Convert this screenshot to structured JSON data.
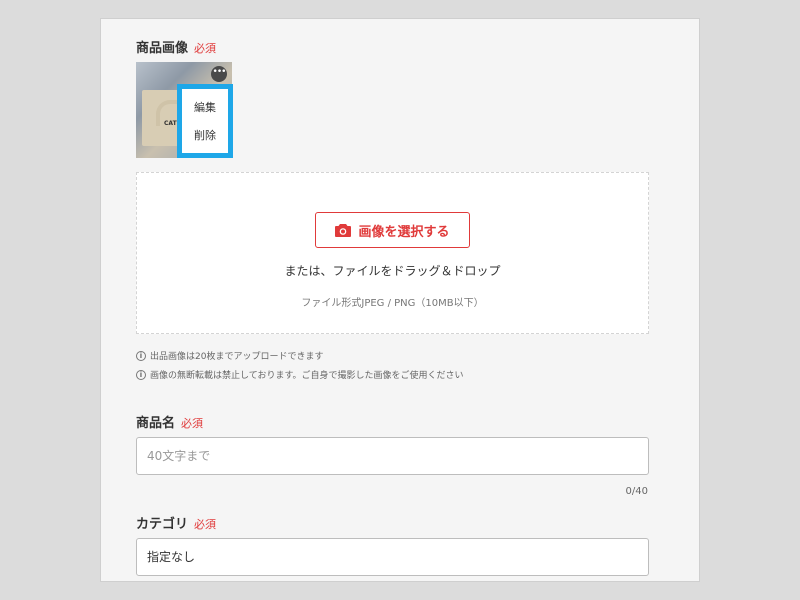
{
  "image_section": {
    "label": "商品画像",
    "required": "必須",
    "thumbnail": {
      "bag_text": "CAT",
      "more_icon": "more-dots-icon",
      "menu": [
        "編集",
        "削除"
      ]
    },
    "dropzone": {
      "button_label": "画像を選択する",
      "button_icon": "camera-icon",
      "drag_text": "または、ファイルをドラッグ＆ドロップ",
      "format_text": "ファイル形式JPEG / PNG（10MB以下）"
    },
    "notes": [
      "出品画像は20枚までアップロードできます",
      "画像の無断転載は禁止しております。ご自身で撮影した画像をご使用ください"
    ],
    "info_icon": "i"
  },
  "name_section": {
    "label": "商品名",
    "required": "必須",
    "placeholder": "40文字まで",
    "value": "",
    "counter": "0/40"
  },
  "category_section": {
    "label": "カテゴリ",
    "required": "必須",
    "selected": "指定なし"
  },
  "colors": {
    "accent": "#e03a3a",
    "highlight": "#1ea7e8"
  }
}
